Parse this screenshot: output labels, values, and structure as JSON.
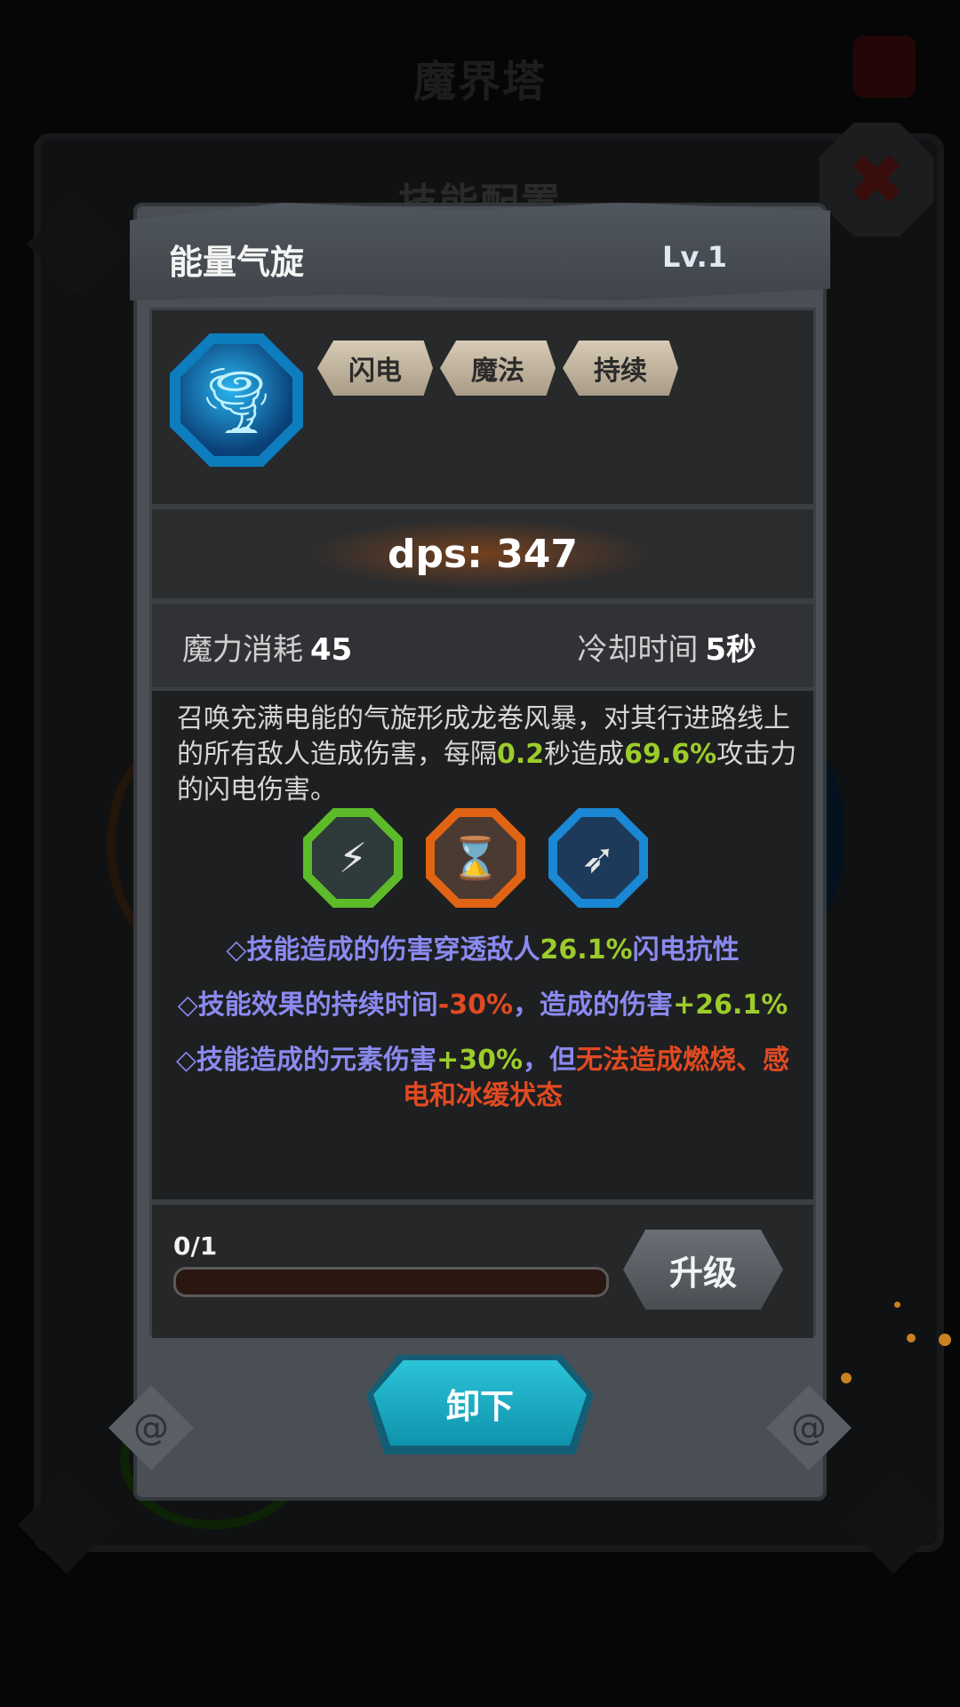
{
  "background": {
    "title": "魔界塔",
    "subtitle": "技能配置"
  },
  "dialog": {
    "title": "能量气旋",
    "level": "Lv.1",
    "skill_icon": "tornado-icon",
    "tags": [
      "闪电",
      "魔法",
      "持续"
    ],
    "dps": "dps: 347",
    "stats": {
      "mana_label": "魔力消耗",
      "mana_value": "45",
      "cooldown_label": "冷却时间",
      "cooldown_value": "5秒"
    },
    "description": {
      "part1": "召唤充满电能的气旋形成龙卷风暴，对其行进路线上的所有敌人造成伤害，每隔",
      "interval": "0.2",
      "part2": "秒造成",
      "percent": "69.6%",
      "part3": "攻击力的闪电伤害。"
    },
    "runes": [
      {
        "name": "lightning-rune-icon",
        "color": "#5dbb2a"
      },
      {
        "name": "hourglass-minus-rune-icon",
        "color": "#e06414"
      },
      {
        "name": "scatter-rune-icon",
        "color": "#1a88d4"
      }
    ],
    "effects": [
      {
        "a": "◇技能造成的伤害穿透敌人",
        "b": "26.1%",
        "c": "闪电抗性"
      },
      {
        "a": "◇技能效果的持续时间",
        "b": "-30%",
        "c": "，造成的伤害",
        "d": "+26.1%"
      },
      {
        "a": "◇技能造成的元素伤害",
        "b": "+30%",
        "c": "，但",
        "d": "无法造成燃烧、感电和冰缓状态"
      }
    ],
    "upgrade": {
      "progress_text": "0/1",
      "progress_fraction": 0,
      "button_label": "升级"
    },
    "unequip_label": "卸下"
  },
  "colors": {
    "accent_green": "#9ccc2a",
    "accent_red": "#e24a22",
    "effect_text": "#8a8af0",
    "button_cyan": "#1fb0c8"
  }
}
